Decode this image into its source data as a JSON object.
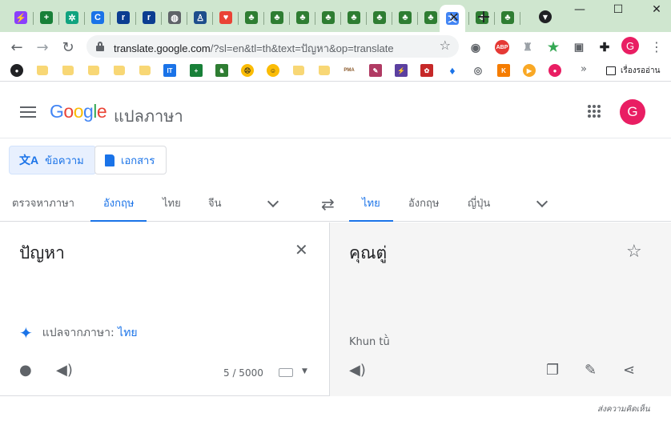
{
  "browser": {
    "tabs": [
      {
        "icon": "messenger-icon",
        "color": "#8a3ffc",
        "glyph": "⚡"
      },
      {
        "icon": "google-sheets-plus-icon",
        "color": "#188038",
        "glyph": "+"
      },
      {
        "icon": "chatgpt-icon",
        "color": "#10a37f",
        "glyph": "✲"
      },
      {
        "icon": "c-letter-icon",
        "color": "#1a73e8",
        "glyph": "C"
      },
      {
        "icon": "r-block-icon",
        "color": "#0b3d91",
        "glyph": "r"
      },
      {
        "icon": "r-block-icon",
        "color": "#0b3d91",
        "glyph": "r"
      },
      {
        "icon": "globe-icon",
        "color": "#5f6368",
        "glyph": "◍"
      },
      {
        "icon": "person-badge-icon",
        "color": "#1e4e8c",
        "glyph": "♙"
      },
      {
        "icon": "colorful-heart-icon",
        "color": "#ea4335",
        "glyph": "♥"
      },
      {
        "icon": "green-app-icon",
        "color": "#2e7d32",
        "glyph": "♣"
      },
      {
        "icon": "green-app-icon",
        "color": "#2e7d32",
        "glyph": "♣"
      },
      {
        "icon": "green-app-icon",
        "color": "#2e7d32",
        "glyph": "♣"
      },
      {
        "icon": "green-app-icon",
        "color": "#2e7d32",
        "glyph": "♣"
      },
      {
        "icon": "green-app-icon",
        "color": "#2e7d32",
        "glyph": "♣"
      },
      {
        "icon": "green-app-icon",
        "color": "#2e7d32",
        "glyph": "♣"
      },
      {
        "icon": "green-app-icon",
        "color": "#2e7d32",
        "glyph": "♣"
      },
      {
        "icon": "green-app-icon",
        "color": "#2e7d32",
        "glyph": "♣"
      },
      {
        "icon": "green-app-icon",
        "color": "#2e7d32",
        "glyph": "♣"
      },
      {
        "icon": "green-app-icon",
        "color": "#2e7d32",
        "glyph": "♣"
      },
      {
        "icon": "green-app-icon",
        "color": "#2e7d32",
        "glyph": "♣"
      }
    ],
    "active_tab_icon": "google-translate-icon",
    "url_main": "translate.google.com",
    "url_rest": "/?sl=en&tl=th&text=ปัญหา&op=translate",
    "profile_initial": "G",
    "reading_list": "เรื่องรออ่าน",
    "bookmark_more": "»"
  },
  "app": {
    "logo": {
      "G": "G",
      "o1": "o",
      "o2": "o",
      "g": "g",
      "l": "l",
      "e": "e"
    },
    "product_name": "แปลภาษา",
    "avatar_initial": "G"
  },
  "modes": {
    "text": "ข้อความ",
    "text_icon": "文A",
    "documents": "เอกสาร"
  },
  "source_langs": {
    "detect": "ตรวจหาภาษา",
    "english": "อังกฤษ",
    "thai": "ไทย",
    "chinese": "จีน"
  },
  "target_langs": {
    "thai": "ไทย",
    "english": "อังกฤษ",
    "japanese": "ญี่ปุ่น"
  },
  "source": {
    "text": "ปัญหา",
    "detected_label": "แปลจากภาษา:",
    "detected_lang": "ไทย",
    "char_count": "5 / 5000"
  },
  "target": {
    "text": "คุณตู่",
    "transliteration": "Khun tū̀"
  },
  "footer": {
    "feedback": "ส่งความคิดเห็น"
  }
}
